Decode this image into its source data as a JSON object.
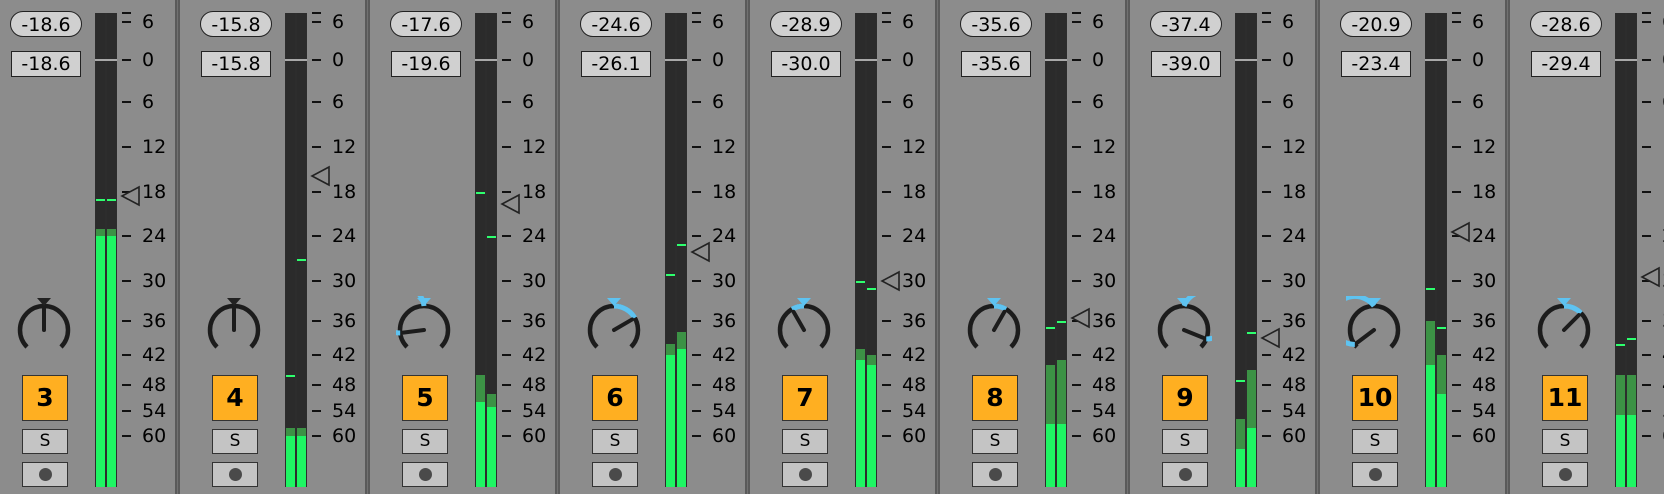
{
  "scale": {
    "ticks": [
      {
        "label": "6",
        "db": 6
      },
      {
        "label": "0",
        "db": 0
      },
      {
        "label": "6",
        "db": -6
      },
      {
        "label": "12",
        "db": -12
      },
      {
        "label": "18",
        "db": -18
      },
      {
        "label": "24",
        "db": -24
      },
      {
        "label": "30",
        "db": -30
      },
      {
        "label": "36",
        "db": -36
      },
      {
        "label": "42",
        "db": -42
      },
      {
        "label": "48",
        "db": -48
      },
      {
        "label": "54",
        "db": -54
      },
      {
        "label": "60",
        "db": -60
      }
    ]
  },
  "colors": {
    "track_button": "#ffaf21",
    "meter_bright": "#1ff563",
    "meter_dark": "#3c9245",
    "pan_indicator": "#5ec3f1"
  },
  "solo_label": "S",
  "strips": [
    {
      "track": "3",
      "peak": "-18.6",
      "volume": "-18.6",
      "fader_db": -18.6,
      "pan": 0,
      "meter": {
        "l": {
          "level": -24,
          "hold": -23,
          "peak": -19
        },
        "r": {
          "level": -24,
          "hold": -23,
          "peak": -19
        }
      }
    },
    {
      "track": "4",
      "peak": "-15.8",
      "volume": "-15.8",
      "fader_db": -15.8,
      "pan": 0,
      "meter": {
        "l": {
          "level": -60,
          "hold": -58,
          "peak": -46
        },
        "r": {
          "level": -60,
          "hold": -58,
          "peak": -27
        }
      }
    },
    {
      "track": "5",
      "peak": "-17.6",
      "volume": "-19.6",
      "fader_db": -19.6,
      "pan": -0.65,
      "meter": {
        "l": {
          "level": -52,
          "hold": -46,
          "peak": -18
        },
        "r": {
          "level": -53,
          "hold": -50,
          "peak": -24
        }
      }
    },
    {
      "track": "6",
      "peak": "-24.6",
      "volume": "-26.1",
      "fader_db": -26.1,
      "pan": 0.4,
      "meter": {
        "l": {
          "level": -42,
          "hold": -40,
          "peak": -29
        },
        "r": {
          "level": -41,
          "hold": -38,
          "peak": -25
        }
      }
    },
    {
      "track": "7",
      "peak": "-28.9",
      "volume": "-30.0",
      "fader_db": -30.0,
      "pan": -0.2,
      "meter": {
        "l": {
          "level": -43,
          "hold": -41,
          "peak": -30
        },
        "r": {
          "level": -44,
          "hold": -42,
          "peak": -31
        }
      }
    },
    {
      "track": "8",
      "peak": "-35.6",
      "volume": "-35.6",
      "fader_db": -35.6,
      "pan": 0.2,
      "meter": {
        "l": {
          "level": -57,
          "hold": -44,
          "peak": -37
        },
        "r": {
          "level": -57,
          "hold": -43,
          "peak": -36
        }
      }
    },
    {
      "track": "9",
      "peak": "-37.4",
      "volume": "-39.0",
      "fader_db": -39.0,
      "pan": 0.75,
      "meter": {
        "l": {
          "level": -62,
          "hold": -56,
          "peak": -47
        },
        "r": {
          "level": -58,
          "hold": -45,
          "peak": -38
        }
      }
    },
    {
      "track": "10",
      "peak": "-20.9",
      "volume": "-23.4",
      "fader_db": -23.4,
      "pan": -0.85,
      "meter": {
        "l": {
          "level": -44,
          "hold": -36,
          "peak": -31
        },
        "r": {
          "level": -50,
          "hold": -42,
          "peak": -37
        }
      }
    },
    {
      "track": "11",
      "peak": "-28.6",
      "volume": "-29.4",
      "fader_db": -29.4,
      "pan": 0.3,
      "meter": {
        "l": {
          "level": -55,
          "hold": -46,
          "peak": -40
        },
        "r": {
          "level": -55,
          "hold": -46,
          "peak": -39
        }
      }
    }
  ]
}
